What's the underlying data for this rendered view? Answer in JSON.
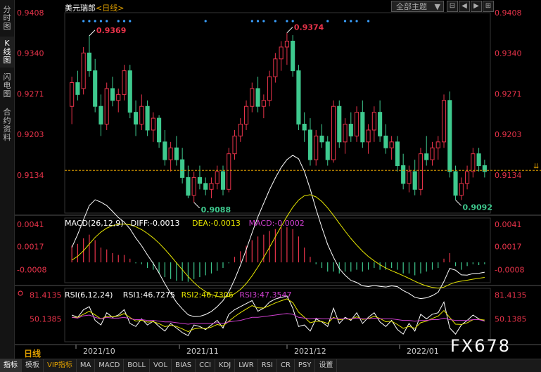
{
  "sidebar": {
    "tabs": [
      {
        "label": "分时图",
        "active": false
      },
      {
        "label": "K线图",
        "active": true
      },
      {
        "label": "闪电图",
        "active": false
      },
      {
        "label": "合约资料",
        "active": false
      }
    ]
  },
  "header": {
    "symbol": "美元瑞郎",
    "period": "<日线>",
    "theme_button": "全部主题",
    "theme_arrow": "▼"
  },
  "window_buttons": [
    "⊟",
    "◀",
    "▶",
    "⊞"
  ],
  "price_axis": {
    "ticks": [
      "0.9408",
      "0.9340",
      "0.9271",
      "0.9203",
      "0.9134"
    ],
    "high_label": "0.9369",
    "high2_label": "0.9374",
    "low_label": "0.9088",
    "low2_label": "0.9092"
  },
  "macd": {
    "header": "MACD(26,12,9)",
    "diff": "DIFF:-0.0013",
    "dea": "DEA:-0.0013",
    "macd": "MACD:-0.0002",
    "ticks": [
      "0.0041",
      "0.0017",
      "-0.0008"
    ]
  },
  "rsi": {
    "header": "RSI(6,12,24)",
    "rsi1": "RSI1:46.7275",
    "rsi2": "RSI2:46.7306",
    "rsi3": "RSI3:47.3547",
    "ticks": [
      "81.4135",
      "50.1385"
    ]
  },
  "time_axis": {
    "labels": [
      "2021/10",
      "2021/11",
      "2021/12",
      "2022/01"
    ],
    "period": "日线"
  },
  "watermark": "FX678",
  "bottom_tabs": [
    {
      "label": "指标",
      "active": true
    },
    {
      "label": "模板"
    },
    {
      "label": "VIP指标",
      "vip": true
    },
    {
      "label": "MA"
    },
    {
      "label": "MACD"
    },
    {
      "label": "BOLL"
    },
    {
      "label": "VOL"
    },
    {
      "label": "BIAS"
    },
    {
      "label": "CCI"
    },
    {
      "label": "KDJ"
    },
    {
      "label": "LWR"
    },
    {
      "label": "RSI"
    },
    {
      "label": "CR"
    },
    {
      "label": "PSY"
    },
    {
      "label": "设置"
    }
  ],
  "colors": {
    "up": "#e8334a",
    "down": "#3ec98e",
    "axis_text": "#e8334a",
    "diff_line": "#ffffff",
    "dea_line": "#e6e600",
    "rsi2": "#e6e600",
    "rsi3": "#d040d0"
  },
  "chart_data": {
    "type": "candlestick",
    "price_range": [
      0.907,
      0.9408
    ],
    "candles": [
      [
        0.925,
        0.93,
        0.922,
        0.929
      ],
      [
        0.929,
        0.931,
        0.926,
        0.927
      ],
      [
        0.928,
        0.935,
        0.927,
        0.934
      ],
      [
        0.934,
        0.9369,
        0.93,
        0.931
      ],
      [
        0.931,
        0.933,
        0.924,
        0.925
      ],
      [
        0.925,
        0.927,
        0.92,
        0.922
      ],
      [
        0.922,
        0.929,
        0.921,
        0.928
      ],
      [
        0.928,
        0.93,
        0.925,
        0.926
      ],
      [
        0.926,
        0.928,
        0.924,
        0.927
      ],
      [
        0.927,
        0.932,
        0.926,
        0.931
      ],
      [
        0.931,
        0.932,
        0.923,
        0.924
      ],
      [
        0.924,
        0.926,
        0.92,
        0.922
      ],
      [
        0.922,
        0.927,
        0.921,
        0.925
      ],
      [
        0.925,
        0.926,
        0.92,
        0.921
      ],
      [
        0.921,
        0.924,
        0.919,
        0.923
      ],
      [
        0.923,
        0.9235,
        0.918,
        0.919
      ],
      [
        0.919,
        0.921,
        0.915,
        0.916
      ],
      [
        0.916,
        0.919,
        0.914,
        0.918
      ],
      [
        0.918,
        0.92,
        0.915,
        0.916
      ],
      [
        0.916,
        0.918,
        0.912,
        0.913
      ],
      [
        0.913,
        0.915,
        0.9095,
        0.91
      ],
      [
        0.91,
        0.914,
        0.9088,
        0.913
      ],
      [
        0.913,
        0.915,
        0.911,
        0.912
      ],
      [
        0.912,
        0.913,
        0.91,
        0.911
      ],
      [
        0.911,
        0.913,
        0.9095,
        0.912
      ],
      [
        0.912,
        0.915,
        0.911,
        0.914
      ],
      [
        0.914,
        0.915,
        0.91,
        0.911
      ],
      [
        0.911,
        0.918,
        0.9105,
        0.917
      ],
      [
        0.917,
        0.921,
        0.916,
        0.92
      ],
      [
        0.92,
        0.923,
        0.919,
        0.922
      ],
      [
        0.922,
        0.926,
        0.921,
        0.925
      ],
      [
        0.925,
        0.929,
        0.924,
        0.928
      ],
      [
        0.928,
        0.93,
        0.924,
        0.925
      ],
      [
        0.925,
        0.927,
        0.923,
        0.926
      ],
      [
        0.926,
        0.931,
        0.925,
        0.93
      ],
      [
        0.93,
        0.934,
        0.929,
        0.933
      ],
      [
        0.933,
        0.936,
        0.931,
        0.935
      ],
      [
        0.935,
        0.9374,
        0.932,
        0.936
      ],
      [
        0.936,
        0.937,
        0.93,
        0.931
      ],
      [
        0.931,
        0.932,
        0.921,
        0.922
      ],
      [
        0.922,
        0.924,
        0.919,
        0.921
      ],
      [
        0.921,
        0.923,
        0.915,
        0.916
      ],
      [
        0.916,
        0.921,
        0.915,
        0.92
      ],
      [
        0.92,
        0.922,
        0.918,
        0.919
      ],
      [
        0.919,
        0.92,
        0.915,
        0.916
      ],
      [
        0.916,
        0.926,
        0.9155,
        0.925
      ],
      [
        0.925,
        0.926,
        0.918,
        0.919
      ],
      [
        0.919,
        0.923,
        0.917,
        0.922
      ],
      [
        0.922,
        0.924,
        0.919,
        0.92
      ],
      [
        0.92,
        0.925,
        0.919,
        0.924
      ],
      [
        0.924,
        0.926,
        0.918,
        0.919
      ],
      [
        0.919,
        0.922,
        0.917,
        0.921
      ],
      [
        0.921,
        0.925,
        0.919,
        0.924
      ],
      [
        0.924,
        0.926,
        0.919,
        0.92
      ],
      [
        0.92,
        0.922,
        0.917,
        0.918
      ],
      [
        0.918,
        0.92,
        0.916,
        0.919
      ],
      [
        0.919,
        0.92,
        0.914,
        0.915
      ],
      [
        0.915,
        0.917,
        0.911,
        0.912
      ],
      [
        0.912,
        0.915,
        0.9105,
        0.914
      ],
      [
        0.914,
        0.916,
        0.91,
        0.911
      ],
      [
        0.911,
        0.918,
        0.91,
        0.917
      ],
      [
        0.917,
        0.92,
        0.915,
        0.916
      ],
      [
        0.916,
        0.919,
        0.915,
        0.918
      ],
      [
        0.918,
        0.92,
        0.916,
        0.919
      ],
      [
        0.919,
        0.927,
        0.918,
        0.926
      ],
      [
        0.926,
        0.9275,
        0.913,
        0.914
      ],
      [
        0.914,
        0.915,
        0.9092,
        0.91
      ],
      [
        0.91,
        0.913,
        0.9092,
        0.912
      ],
      [
        0.912,
        0.915,
        0.911,
        0.914
      ],
      [
        0.914,
        0.918,
        0.913,
        0.917
      ],
      [
        0.917,
        0.918,
        0.914,
        0.915
      ],
      [
        0.915,
        0.916,
        0.913,
        0.914
      ]
    ],
    "current_price": 0.9142,
    "macd_range": [
      -0.0022,
      0.0048
    ],
    "macd_hist": [
      0.0018,
      0.002,
      0.0026,
      0.003,
      0.0024,
      0.0016,
      0.0014,
      0.001,
      0.0008,
      0.0008,
      0.0004,
      -0.0001,
      -0.0002,
      -0.0006,
      -0.0008,
      -0.0012,
      -0.0016,
      -0.0018,
      -0.002,
      -0.002,
      -0.0021,
      -0.0018,
      -0.0016,
      -0.0014,
      -0.0012,
      -0.0009,
      -0.0006,
      -0.0001,
      0.0006,
      0.0012,
      0.0018,
      0.0024,
      0.0028,
      0.003,
      0.0034,
      0.0036,
      0.0038,
      0.0038,
      0.0036,
      0.0028,
      0.0016,
      0.0006,
      -0.0002,
      -0.0006,
      -0.001,
      -0.001,
      -0.0012,
      -0.001,
      -0.001,
      -0.0008,
      -0.001,
      -0.0008,
      -0.0006,
      -0.0008,
      -0.0008,
      -0.0006,
      -0.0008,
      -0.0012,
      -0.0012,
      -0.0014,
      -0.0012,
      -0.001,
      -0.0008,
      -0.0006,
      0.0004,
      0.001,
      -0.0004,
      -0.0008,
      -0.0004,
      -0.0002,
      -0.0003,
      -0.0002
    ],
    "rsi_range": [
      20,
      90
    ],
    "rsi1": [
      55,
      52,
      62,
      66,
      48,
      42,
      58,
      52,
      55,
      62,
      44,
      40,
      50,
      42,
      47,
      40,
      34,
      44,
      38,
      32,
      28,
      42,
      40,
      36,
      42,
      48,
      38,
      56,
      62,
      66,
      70,
      74,
      60,
      64,
      72,
      76,
      78,
      80,
      64,
      40,
      42,
      34,
      50,
      46,
      40,
      64,
      44,
      52,
      48,
      58,
      44,
      52,
      58,
      46,
      40,
      48,
      36,
      30,
      44,
      34,
      56,
      50,
      56,
      58,
      72,
      38,
      30,
      42,
      48,
      55,
      50,
      47
    ],
    "rsi3": [
      52,
      51,
      54,
      55,
      52,
      50,
      52,
      51,
      51,
      52,
      50,
      49,
      49,
      48,
      48,
      47,
      46,
      46,
      45,
      44,
      43,
      44,
      44,
      44,
      44,
      45,
      44,
      46,
      47,
      48,
      50,
      52,
      52,
      53,
      54,
      55,
      56,
      57,
      56,
      52,
      51,
      50,
      51,
      50,
      50,
      51,
      50,
      50,
      50,
      51,
      50,
      50,
      51,
      50,
      50,
      50,
      49,
      48,
      48,
      47,
      48,
      48,
      49,
      49,
      51,
      49,
      48,
      48,
      48,
      49,
      49,
      47
    ]
  }
}
